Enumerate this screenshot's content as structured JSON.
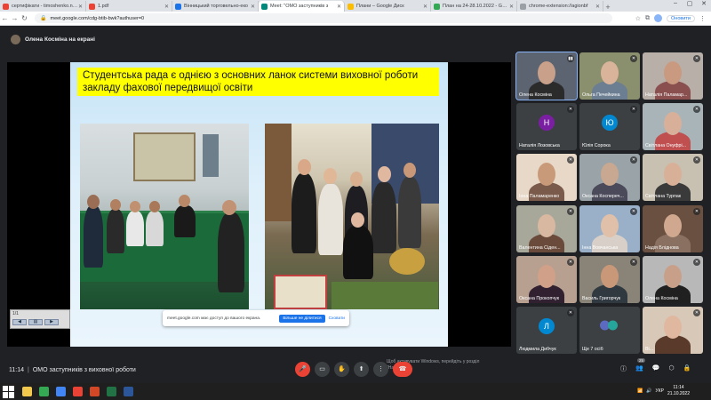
{
  "browser": {
    "tabs": [
      {
        "label": "сертифікати - timoshenko.nata",
        "color": "#ea4335",
        "active": false
      },
      {
        "label": "1.pdf",
        "color": "#ea4335",
        "active": false
      },
      {
        "label": "Вінницький торговельно-еко",
        "color": "#1a73e8",
        "active": false
      },
      {
        "label": "Meet: \"ОМО заступників з",
        "color": "#00897b",
        "active": true
      },
      {
        "label": "Плани – Google Диск",
        "color": "#fbbc04",
        "active": false
      },
      {
        "label": "План на 24-28.10.2022 - Goog",
        "color": "#34a853",
        "active": false
      },
      {
        "label": "chrome-extension://agionbf",
        "color": "#9aa0a6",
        "active": false
      }
    ],
    "new_tab": "+",
    "url": "meet.google.com/cdg-btib-bwk?authuser=0",
    "update_button": "Оновити"
  },
  "presenter": {
    "label": "Олена Косміна на екрані"
  },
  "slide": {
    "title": "Студентська рада є однією з основних ланок системи виховної роботи закладу фахової передвищої освіти",
    "page_indicator": "1/1",
    "activate_text": "Щоб активувати Windows, перейдіть у розділ \"Настройки\"."
  },
  "notification": {
    "message": "meet.google.com має доступ до вашого екрана.",
    "stop_button": "Більше не ділитися",
    "hide_button": "Сховати"
  },
  "participants": [
    {
      "name": "Олена Косміна",
      "type": "video",
      "bg": "#5b6470",
      "face": "#c9a08a",
      "body": "#2b2b2b",
      "active": true,
      "mic": "▮▮"
    },
    {
      "name": "Ольга Печейкина",
      "type": "video",
      "bg": "#8a8f6e",
      "face": "#d9b49a",
      "body": "#6b7e92",
      "mic": "✕"
    },
    {
      "name": "Наталія Паламар...",
      "type": "video",
      "bg": "#b8b0a8",
      "face": "#c99a80",
      "body": "#8a5050",
      "mic": "✕"
    },
    {
      "name": "Наталія Лозовська",
      "type": "initial",
      "initial": "Н",
      "color": "#7b1fa2",
      "mic": "✕"
    },
    {
      "name": "Юлія Сорока",
      "type": "initial",
      "initial": "Ю",
      "color": "#0288d1",
      "mic": "✕"
    },
    {
      "name": "Світлана Онуфрі...",
      "type": "video",
      "bg": "#a8b4b8",
      "face": "#d8b09a",
      "body": "#c05050",
      "mic": "✕"
    },
    {
      "name": "Інна Паламаренко",
      "type": "video",
      "bg": "#e8d8c8",
      "face": "#c89a7a",
      "body": "#7a5a4a",
      "mic": "✕"
    },
    {
      "name": "Оксана Коспереч...",
      "type": "video",
      "bg": "#9aa4a8",
      "face": "#c8a890",
      "body": "#4a4a5a",
      "mic": "✕"
    },
    {
      "name": "Світлана Турпак",
      "type": "video",
      "bg": "#c8c0b0",
      "face": "#d8b098",
      "body": "#3a3a3a",
      "mic": "✕"
    },
    {
      "name": "Валентина Сіден...",
      "type": "video",
      "bg": "#a8a89a",
      "face": "#d8b8a0",
      "body": "#6a4a3a",
      "mic": "✕"
    },
    {
      "name": "Інна Вовчанська",
      "type": "video",
      "bg": "#9ab0c8",
      "face": "#e0c0a8",
      "body": "#d8d0c8",
      "mic": "✕"
    },
    {
      "name": "Надія Бліднова",
      "type": "video",
      "bg": "#6a5040",
      "face": "#d0a890",
      "body": "#8a7060",
      "mic": "✕"
    },
    {
      "name": "Оксана Прокопчук",
      "type": "video",
      "bg": "#b8a090",
      "face": "#d0a088",
      "body": "#302030",
      "mic": "✕"
    },
    {
      "name": "Василь Григорчук",
      "type": "video",
      "bg": "#8a8478",
      "face": "#c89878",
      "body": "#303840",
      "mic": "✕"
    },
    {
      "name": "Олена Косміна",
      "type": "video",
      "bg": "#b8b8b8",
      "face": "#c8a08a",
      "body": "#202020",
      "mic": "✕"
    },
    {
      "name": "Людмила Дибчук",
      "type": "initial",
      "initial": "Л",
      "color": "#0288d1",
      "mic": "✕"
    },
    {
      "name": "Ще 7 осіб",
      "type": "others",
      "mic": ""
    },
    {
      "name": "Ві...",
      "type": "video",
      "bg": "#d8c8b8",
      "face": "#e0b8a0",
      "body": "#5a3a2a",
      "mic": "✕"
    }
  ],
  "bottom": {
    "time": "11:14",
    "meeting_name": "ОМО заступників з виховної роботи",
    "participant_count": "25",
    "controls": {
      "mic": "🎤",
      "camera": "▭",
      "raise_hand": "✋",
      "present": "⬆",
      "more": "⋮",
      "end_call": "☎"
    },
    "right": {
      "info": "ⓘ",
      "people": "👥",
      "chat": "💬",
      "activities": "⬡",
      "admin": "🔒"
    }
  },
  "taskbar": {
    "apps": [
      {
        "name": "file-explorer",
        "color": "#f2c94c"
      },
      {
        "name": "chrome",
        "color": "#34a853"
      },
      {
        "name": "chrome-2",
        "color": "#4285f4"
      },
      {
        "name": "chrome-3",
        "color": "#ea4335"
      },
      {
        "name": "powerpoint",
        "color": "#d24726"
      },
      {
        "name": "excel",
        "color": "#217346"
      },
      {
        "name": "word",
        "color": "#2b579a"
      }
    ],
    "lang": "УКР",
    "clock_time": "11:14",
    "clock_date": "21.10.2022"
  }
}
